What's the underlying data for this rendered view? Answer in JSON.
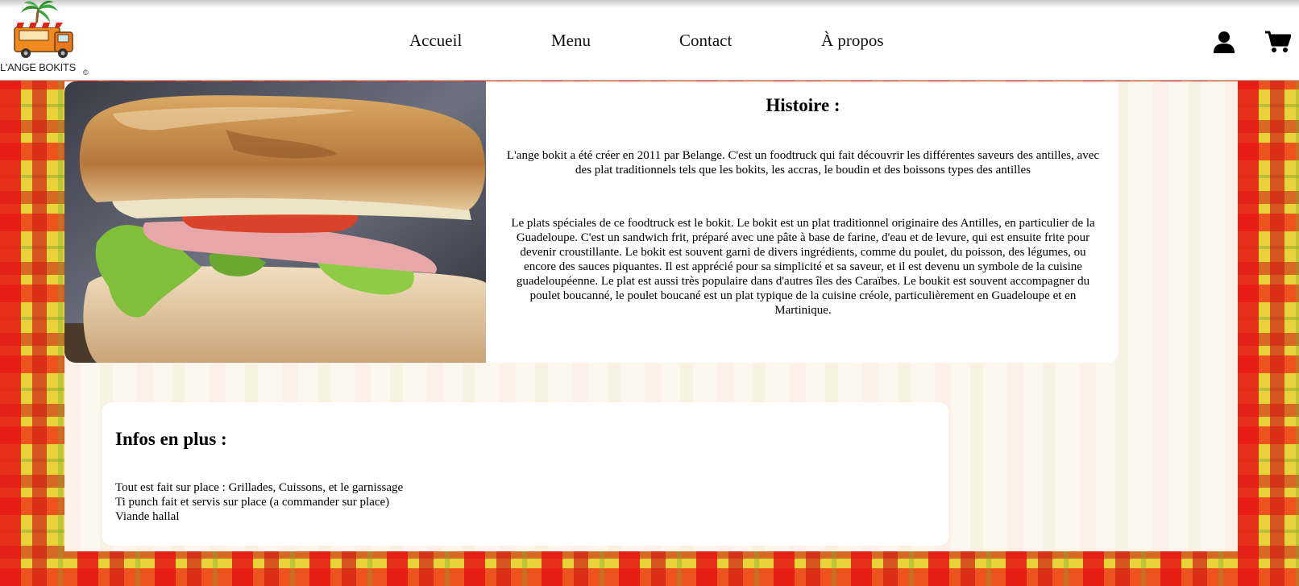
{
  "brand": {
    "name": "L'ANGE BOKITS",
    "copyright_mark": "©"
  },
  "nav": {
    "items": [
      {
        "label": "Accueil"
      },
      {
        "label": "Menu"
      },
      {
        "label": "Contact"
      },
      {
        "label": "À propos"
      }
    ]
  },
  "header_icons": {
    "account": "user-icon",
    "cart": "cart-icon"
  },
  "histoire": {
    "title": "Histoire :",
    "paragraph_1": "L'ange bokit a été créer en 2011 par Belange. C'est un foodtruck qui fait découvrir les différentes saveurs des antilles, avec des plat traditionnels tels que les bokits, les accras, le boudin et des boissons types des antilles",
    "paragraph_2": "Le plats spéciales de ce foodtruck est le bokit. Le bokit est un plat traditionnel originaire des Antilles, en particulier de la Guadeloupe. C'est un sandwich frit, préparé avec une pâte à base de farine, d'eau et de levure, qui est ensuite frite pour devenir croustillante. Le bokit est souvent garni de divers ingrédients, comme du poulet, du poisson, des légumes, ou encore des sauces piquantes. Il est apprécié pour sa simplicité et sa saveur, et il est devenu un symbole de la cuisine guadeloupéenne. Le plat est aussi très populaire dans d'autres îles des Caraïbes. Le boukit est souvent accompagner du poulet boucanné, le poulet boucané est un plat typique de la cuisine créole, particulièrement en Guadeloupe et en Martinique."
  },
  "infos": {
    "title": "Infos en plus :",
    "items": [
      "Tout est fait sur place : Grillades, Cuissons, et le garnissage",
      "Ti punch fait et servis sur place (a commander sur place)",
      "Viande hallal"
    ]
  },
  "colors": {
    "madras_red": "#e61414",
    "madras_yellow": "#e8d23a",
    "madras_green": "#78aa28",
    "panel": "#fbf6ee",
    "card": "#ffffff"
  }
}
